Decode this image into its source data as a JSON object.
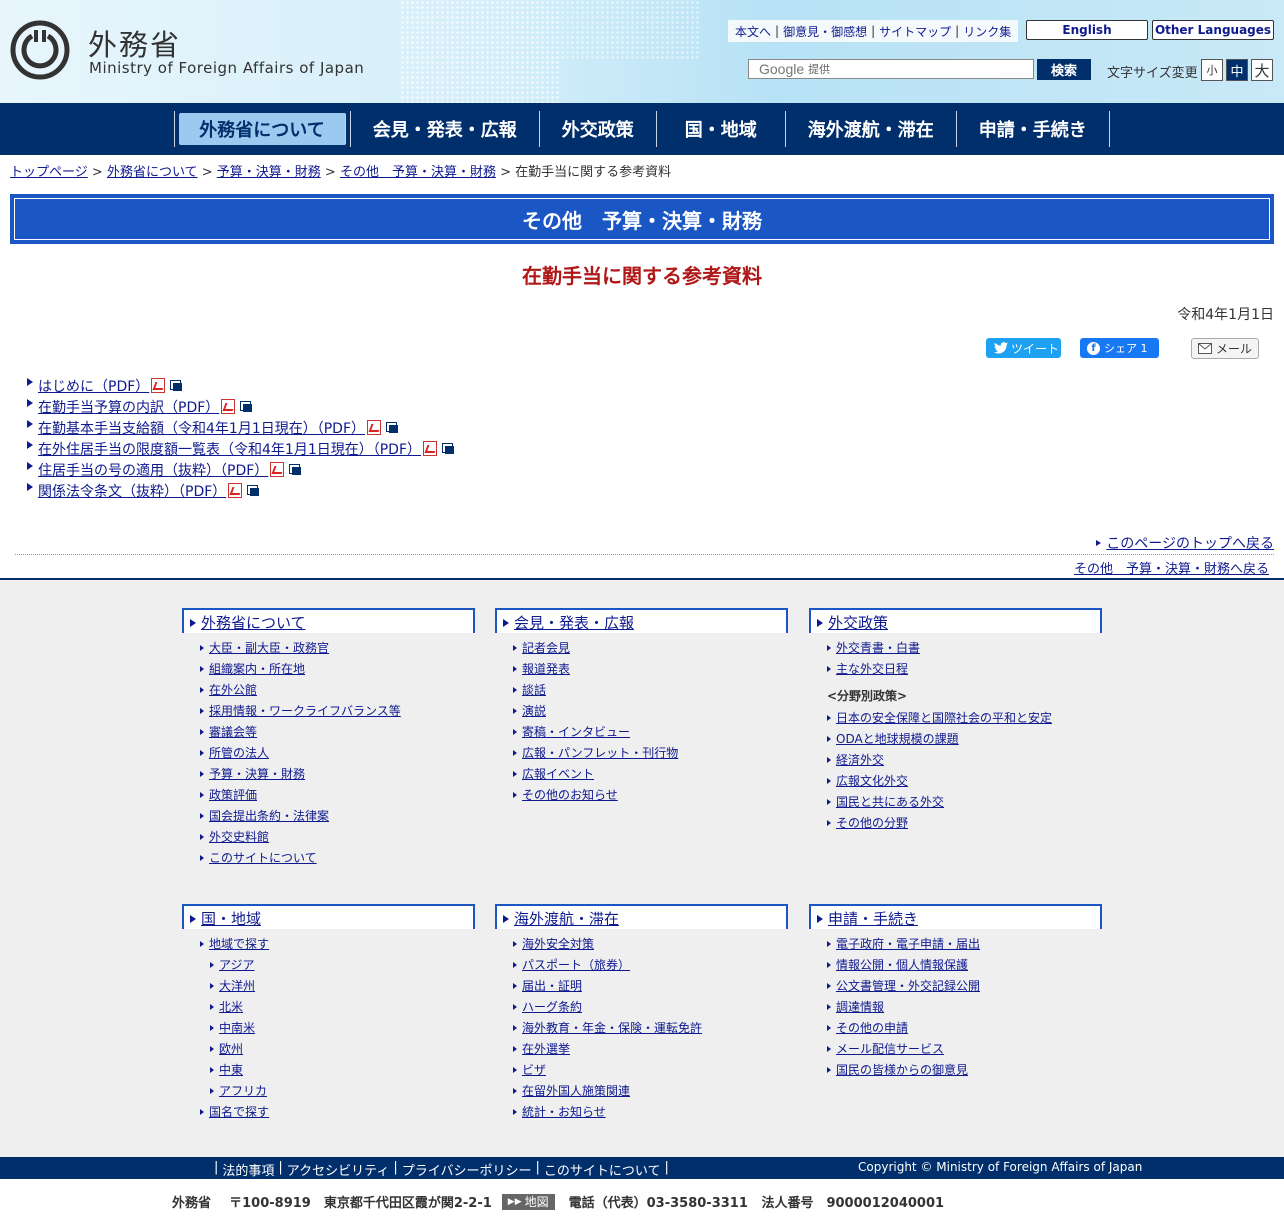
{
  "header": {
    "logo_jp": "外務省",
    "logo_en": "Ministry of Foreign Affairs of Japan",
    "util_links": [
      "本文へ",
      "御意見・御感想",
      "サイトマップ",
      "リンク集"
    ],
    "english": "English",
    "other_languages": "Other Languages",
    "search_brand": "Google",
    "search_provided": "提供",
    "search_button": "検索",
    "font_size_label": "文字サイズ変更",
    "font_sizes": [
      "小",
      "中",
      "大"
    ],
    "font_size_selected": "中"
  },
  "nav": {
    "items": [
      "外務省について",
      "会見・発表・広報",
      "外交政策",
      "国・地域",
      "海外渡航・滞在",
      "申請・手続き"
    ],
    "active": "外務省について"
  },
  "breadcrumb": {
    "links": [
      "トップページ",
      "外務省について",
      "予算・決算・財務",
      "その他　予算・決算・財務"
    ],
    "separator": ">",
    "current": "在勤手当に関する参考資料"
  },
  "section_title": "その他　予算・決算・財務",
  "page_title": "在勤手当に関する参考資料",
  "date": "令和4年1月1日",
  "share": {
    "tweet": "ツイート",
    "fb_share": "シェア 1",
    "mail": "メール"
  },
  "documents": [
    "はじめに（PDF）",
    "在勤手当予算の内訳（PDF）",
    "在勤基本手当支給額（令和4年1月1日現在）（PDF）",
    "在外住居手当の限度額一覧表（令和4年1月1日現在）（PDF）",
    "住居手当の号の適用（抜粋）（PDF）",
    "関係法令条文（抜粋）（PDF）"
  ],
  "to_top": "このページのトップへ戻る",
  "back_link": "その他　予算・決算・財務へ戻る",
  "footer": {
    "columns": [
      {
        "title": "外務省について",
        "items": [
          "大臣・副大臣・政務官",
          "組織案内・所在地",
          "在外公館",
          "採用情報・ワークライフバランス等",
          "審議会等",
          "所管の法人",
          "予算・決算・財務",
          "政策評価",
          "国会提出条約・法律案",
          "外交史料館",
          "このサイトについて"
        ]
      },
      {
        "title": "会見・発表・広報",
        "items": [
          "記者会見",
          "報道発表",
          "談話",
          "演説",
          "寄稿・インタビュー",
          "広報・パンフレット・刊行物",
          "広報イベント",
          "その他のお知らせ"
        ]
      },
      {
        "title": "外交政策",
        "items_top": [
          "外交青書・白書",
          "主な外交日程"
        ],
        "label": "<分野別政策>",
        "items": [
          "日本の安全保障と国際社会の平和と安定",
          "ODAと地球規模の課題",
          "経済外交",
          "広報文化外交",
          "国民と共にある外交",
          "その他の分野"
        ]
      },
      {
        "title": "国・地域",
        "items": [
          "地域で探す",
          "アジア",
          "大洋州",
          "北米",
          "中南米",
          "欧州",
          "中東",
          "アフリカ",
          "国名で探す"
        ]
      },
      {
        "title": "海外渡航・滞在",
        "items": [
          "海外安全対策",
          "パスポート（旅券）",
          "届出・証明",
          "ハーグ条約",
          "海外教育・年金・保険・運転免許",
          "在外選挙",
          "ビザ",
          "在留外国人施策関連",
          "統計・お知らせ"
        ]
      },
      {
        "title": "申請・手続き",
        "items": [
          "電子政府・電子申請・届出",
          "情報公開・個人情報保護",
          "公文書管理・外交記録公開",
          "調達情報",
          "その他の申請",
          "メール配信サービス",
          "国民の皆様からの御意見"
        ]
      }
    ]
  },
  "bottom": {
    "links": [
      "法的事項",
      "アクセシビリティ",
      "プライバシーポリシー",
      "このサイトについて"
    ],
    "copyright": "Copyright © Ministry of Foreign Affairs of Japan",
    "org": "外務省",
    "address": "〒100-8919　東京都千代田区霞が関2-2-1",
    "map_button": "地図",
    "phone": "電話（代表）03-3580-3311",
    "corp_no": "法人番号　9000012040001"
  },
  "colors": {
    "navy": "#002f6c",
    "title_blue": "#1a56c4",
    "title_red": "#b01818",
    "link": "#0f1a8f"
  }
}
